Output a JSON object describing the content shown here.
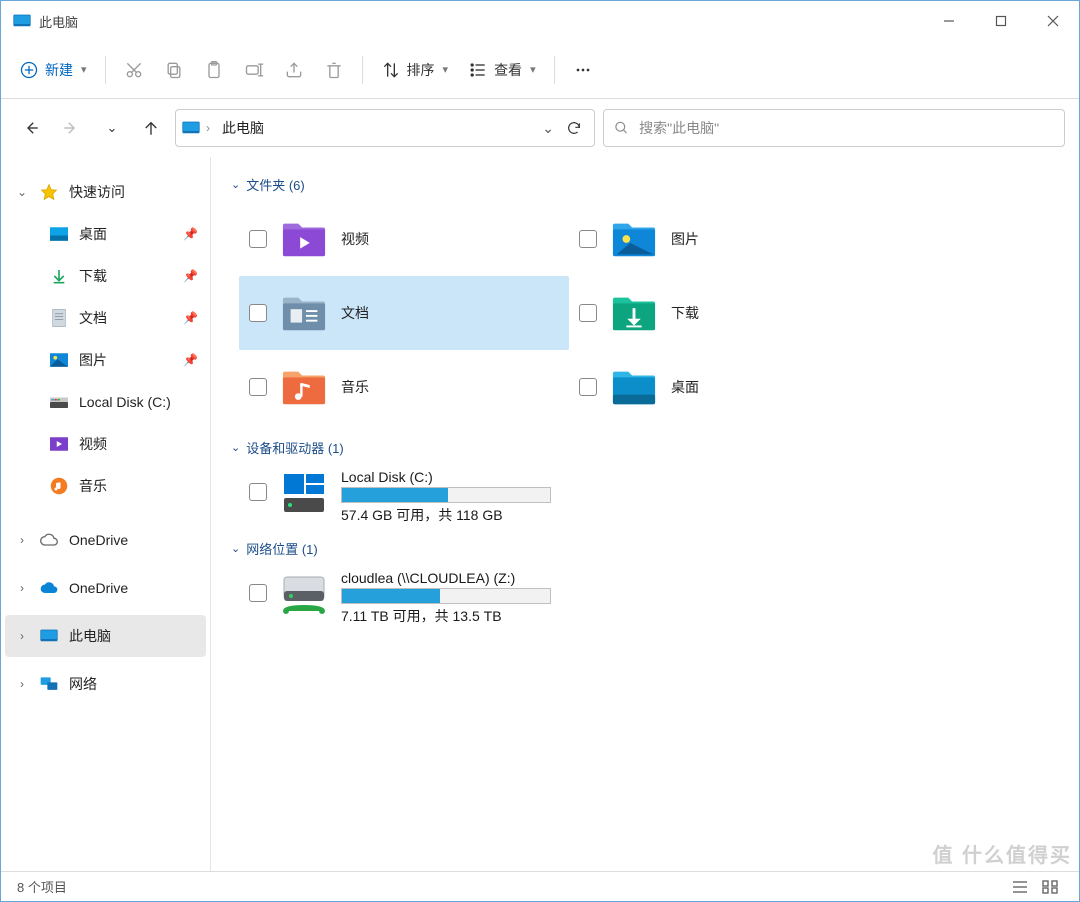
{
  "window": {
    "title": "此电脑"
  },
  "toolbar": {
    "new_label": "新建",
    "sort_label": "排序",
    "view_label": "查看"
  },
  "address": {
    "crumb0": "此电脑"
  },
  "search": {
    "placeholder": "搜索\"此电脑\""
  },
  "sidebar": {
    "quick_access": "快速访问",
    "items": [
      {
        "label": "桌面",
        "pinned": true
      },
      {
        "label": "下载",
        "pinned": true
      },
      {
        "label": "文档",
        "pinned": true
      },
      {
        "label": "图片",
        "pinned": true
      },
      {
        "label": "Local Disk (C:)",
        "pinned": false
      },
      {
        "label": "视频",
        "pinned": false
      },
      {
        "label": "音乐",
        "pinned": false
      }
    ],
    "onedrive1": "OneDrive",
    "onedrive2": "OneDrive",
    "this_pc": "此电脑",
    "network": "网络"
  },
  "groups": {
    "folders_hdr": "文件夹 (6)",
    "devices_hdr": "设备和驱动器 (1)",
    "network_hdr": "网络位置 (1)"
  },
  "folders": [
    {
      "label": "视频"
    },
    {
      "label": "图片"
    },
    {
      "label": "文档"
    },
    {
      "label": "下载"
    },
    {
      "label": "音乐"
    },
    {
      "label": "桌面"
    }
  ],
  "drives": [
    {
      "label": "Local Disk (C:)",
      "sub": "57.4 GB 可用，共 118 GB",
      "used_pct": 51
    }
  ],
  "netloc": [
    {
      "label": "cloudlea (\\\\CLOUDLEA) (Z:)",
      "sub": "7.11 TB 可用，共 13.5 TB",
      "used_pct": 47
    }
  ],
  "status": {
    "items": "8 个项目"
  },
  "watermark": "值 什么值得买"
}
